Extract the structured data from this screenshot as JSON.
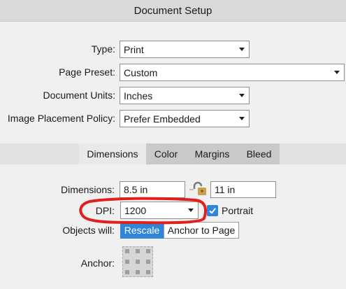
{
  "window": {
    "title": "Document Setup"
  },
  "general": {
    "type": {
      "label": "Type:",
      "value": "Print"
    },
    "page_preset": {
      "label": "Page Preset:",
      "value": "Custom"
    },
    "document_units": {
      "label": "Document Units:",
      "value": "Inches"
    },
    "image_placement_policy": {
      "label": "Image Placement Policy:",
      "value": "Prefer Embedded"
    }
  },
  "tabs": [
    {
      "label": "Dimensions",
      "active": true
    },
    {
      "label": "Color",
      "active": false
    },
    {
      "label": "Margins",
      "active": false
    },
    {
      "label": "Bleed",
      "active": false
    }
  ],
  "dimensions": {
    "label": "Dimensions:",
    "width": "8.5 in",
    "height": "11 in",
    "lock_icon": "lock-icon"
  },
  "dpi": {
    "label": "DPI:",
    "value": "1200"
  },
  "portrait": {
    "label": "Portrait",
    "checked": true
  },
  "objects_will": {
    "label": "Objects will:",
    "options": [
      "Rescale",
      "Anchor to Page"
    ],
    "selected": "Rescale"
  },
  "anchor": {
    "label": "Anchor:"
  },
  "colors": {
    "accent": "#2f86d8",
    "annotation": "#e0201c"
  }
}
